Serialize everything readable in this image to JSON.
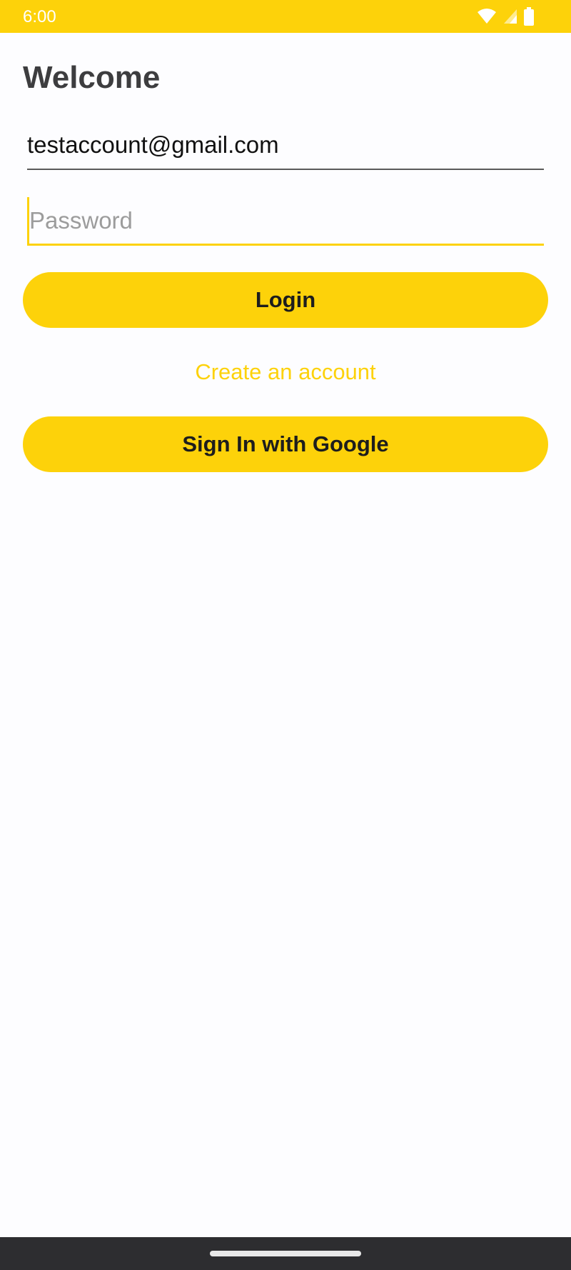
{
  "status_bar": {
    "time": "6:00",
    "background_color": "#fdd20a",
    "icons": [
      "wifi-icon",
      "signal-icon",
      "battery-icon"
    ]
  },
  "page": {
    "title": "Welcome"
  },
  "form": {
    "email_value": "testaccount@gmail.com",
    "password_placeholder": "Password",
    "login_label": "Login",
    "create_account_label": "Create an account",
    "google_label": "Sign In with Google"
  },
  "theme": {
    "accent": "#fdd20a",
    "background": "#fdfdff",
    "text_dark": "#1d1d1d",
    "nav_bar": "#2d2d30"
  }
}
